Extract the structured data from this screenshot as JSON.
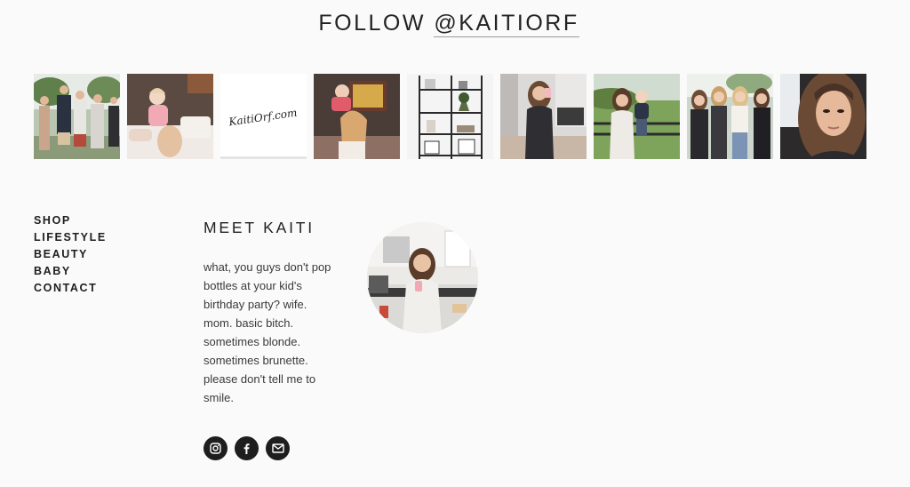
{
  "follow": {
    "prefix": "FOLLOW",
    "handle": "@KAITIORF"
  },
  "instagram_photos": [
    {
      "icon": "family-group-photo"
    },
    {
      "icon": "baby-on-bed-photo"
    },
    {
      "icon": "kaitiorf-logo-photo",
      "caption": "KaitiOrf.com"
    },
    {
      "icon": "mom-holding-baby-photo"
    },
    {
      "icon": "shelving-decor-photo"
    },
    {
      "icon": "mirror-selfie-photo"
    },
    {
      "icon": "mom-with-toddler-outdoors-photo"
    },
    {
      "icon": "group-of-friends-photo"
    },
    {
      "icon": "car-selfie-photo"
    }
  ],
  "nav": {
    "items": [
      "SHOP",
      "LIFESTYLE",
      "BEAUTY",
      "BABY",
      "CONTACT"
    ]
  },
  "about": {
    "title": "MEET KAITI",
    "bio": "what, you guys don't pop bottles at your kid's birthday party? wife. mom. basic bitch. sometimes blonde. sometimes brunette. please don't tell me to smile."
  },
  "social": {
    "icons": [
      "instagram-icon",
      "facebook-icon",
      "email-icon"
    ]
  }
}
